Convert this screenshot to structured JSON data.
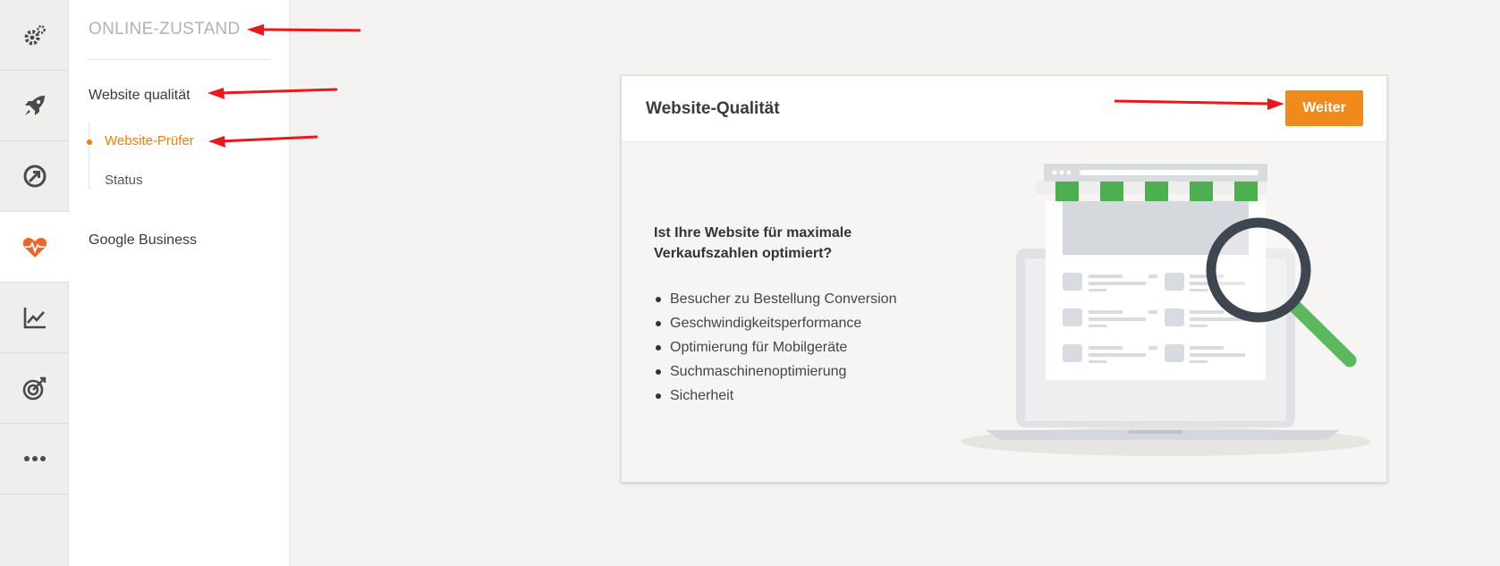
{
  "sidebar_icons": [
    {
      "name": "settings-gears-icon",
      "active": false
    },
    {
      "name": "rocket-icon",
      "active": false
    },
    {
      "name": "gauge-arrow-icon",
      "active": false
    },
    {
      "name": "heart-pulse-icon",
      "active": true
    },
    {
      "name": "line-chart-icon",
      "active": false
    },
    {
      "name": "target-icon",
      "active": false
    },
    {
      "name": "more-dots-icon",
      "active": false
    }
  ],
  "subnav": {
    "section_title": "ONLINE-ZUSTAND",
    "website_quality": "Website qualität",
    "items": [
      "Website-Prüfer",
      "Status"
    ],
    "active_item": "Website-Prüfer",
    "google_business": "Google Business"
  },
  "card": {
    "title": "Website-Qualität",
    "button": "Weiter",
    "question": "Ist Ihre Website für maximale Verkaufszahlen optimiert?",
    "bullets": [
      "Besucher zu Bestellung Conversion",
      "Geschwindigkeitsperformance",
      "Optimierung für Mobilgeräte",
      "Suchmaschinenoptimierung",
      "Sicherheit"
    ]
  },
  "colors": {
    "accent": "#f07d05",
    "button": "#f08a1c",
    "active_icon": "#f0642a",
    "annotation": "#e8191c",
    "awning_green": "#4caf50"
  }
}
